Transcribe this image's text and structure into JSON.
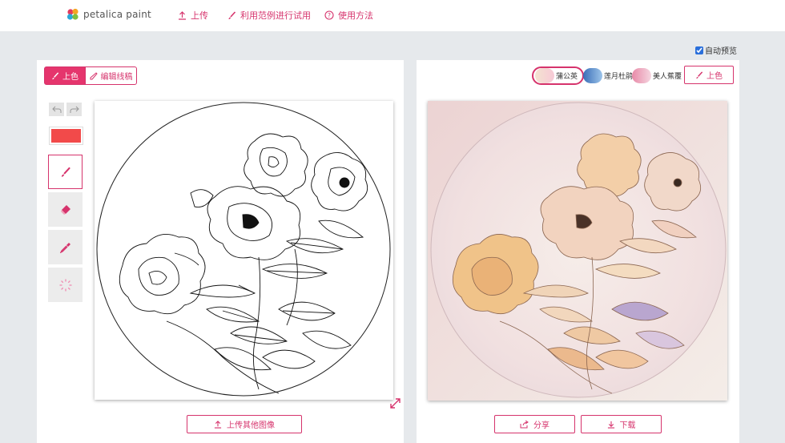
{
  "app": {
    "brand": "petalica paint"
  },
  "nav": [
    {
      "label": "上传",
      "icon": "upload-icon"
    },
    {
      "label": "利用范例进行试用",
      "icon": "brush-icon"
    },
    {
      "label": "使用方法",
      "icon": "help-icon"
    }
  ],
  "options": {
    "auto_preview_label": "自动预览",
    "auto_preview_checked": true
  },
  "left_panel": {
    "mode_tabs": [
      {
        "label": "上色",
        "icon": "brush-icon",
        "active": true
      },
      {
        "label": "编辑线稿",
        "icon": "pencil-icon",
        "active": false
      }
    ],
    "tools": [
      {
        "name": "undo",
        "icon": "undo-icon"
      },
      {
        "name": "redo",
        "icon": "redo-icon"
      },
      {
        "name": "color",
        "value": "#f24a4a"
      },
      {
        "name": "brush",
        "icon": "brush-icon",
        "selected": true
      },
      {
        "name": "eraser",
        "icon": "eraser-icon"
      },
      {
        "name": "eyedropper",
        "icon": "eyedropper-icon"
      },
      {
        "name": "loading",
        "icon": "spinner-icon"
      }
    ],
    "upload_other_label": "上传其他图像"
  },
  "right_panel": {
    "styles": [
      {
        "label": "蒲公英",
        "selected": true
      },
      {
        "label": "莲月杜鹃",
        "selected": false
      },
      {
        "label": "美人蕉覆",
        "selected": false
      }
    ],
    "colorize_label": "上色",
    "share_label": "分享",
    "download_label": "下载"
  },
  "colors": {
    "accent": "#d6336c",
    "accent_fill": "#e5356d",
    "background": "#e6e9ec"
  }
}
